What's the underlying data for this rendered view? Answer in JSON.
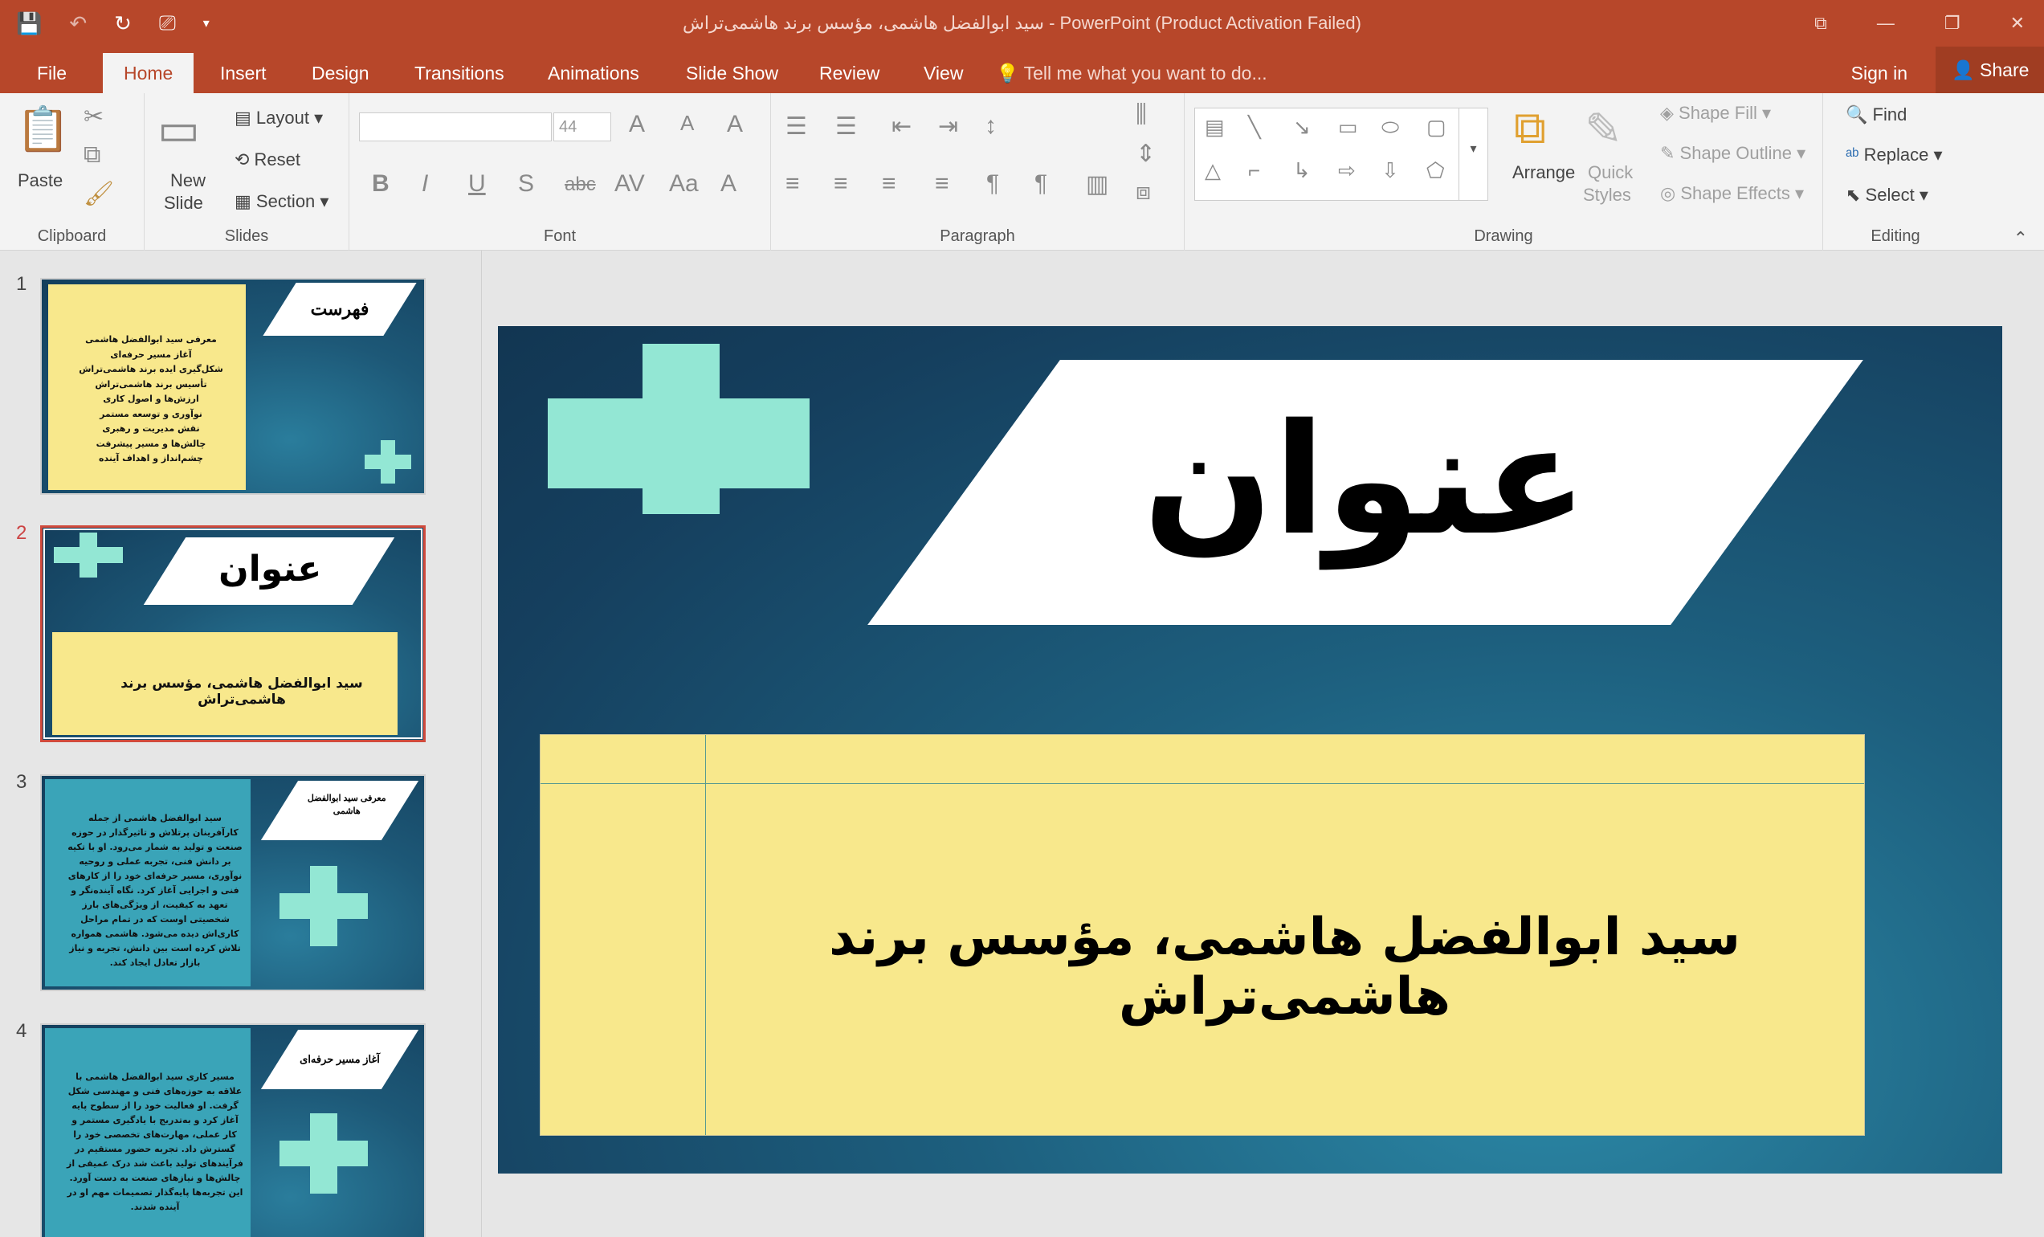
{
  "window": {
    "title": "سید ابوالفضل هاشمی، مؤسس برند هاشمی‌تراش  -  PowerPoint (Product Activation Failed)",
    "controls": [
      "⧉",
      "—",
      "❐",
      "✕"
    ]
  },
  "qat": [
    "save-icon",
    "undo-icon",
    "redo-icon",
    "present-icon",
    "customize-icon"
  ],
  "tabs": [
    "File",
    "Home",
    "Insert",
    "Design",
    "Transitions",
    "Animations",
    "Slide Show",
    "Review",
    "View"
  ],
  "tell_me": "Tell me what you want to do...",
  "sign_in": "Sign in",
  "share": "Share",
  "ribbon": {
    "clipboard": {
      "label": "Clipboard",
      "paste": "Paste"
    },
    "slides": {
      "label": "Slides",
      "new_slide": "New",
      "new_slide2": "Slide",
      "layout": "Layout",
      "reset": "Reset",
      "section": "Section"
    },
    "font": {
      "label": "Font",
      "size": "44",
      "bold": "B",
      "italic": "I",
      "underline": "U",
      "shadow": "S",
      "strike": "abc",
      "spacing": "AV",
      "case": "Aa",
      "color": "A"
    },
    "paragraph": {
      "label": "Paragraph"
    },
    "drawing": {
      "label": "Drawing",
      "arrange": "Arrange",
      "quick": "Quick",
      "styles": "Styles",
      "fill": "Shape Fill",
      "outline": "Shape Outline",
      "effects": "Shape Effects"
    },
    "editing": {
      "label": "Editing",
      "find": "Find",
      "replace": "Replace",
      "select": "Select"
    }
  },
  "thumbs": [
    {
      "num": "1",
      "title": "فهرست",
      "items": [
        "معرفی سید ابوالفضل هاشمی",
        "آغاز مسیر حرفه‌ای",
        "شکل‌گیری ایده برند هاشمی‌تراش",
        "تأسیس برند هاشمی‌تراش",
        "ارزش‌ها و اصول کاری",
        "نوآوری و توسعه مستمر",
        "نقش مدیریت و رهبری",
        "چالش‌ها و مسیر پیشرفت",
        "چشم‌انداز و اهداف آینده"
      ]
    },
    {
      "num": "2",
      "title": "عنوان",
      "sub": "سید ابوالفضل هاشمی، مؤسس برند هاشمی‌تراش"
    },
    {
      "num": "3",
      "title": "معرفی سید ابوالفضل هاشمی",
      "body": "سید ابوالفضل هاشمی از جمله کارآفرینان پرتلاش و تاثیرگذار در حوزه صنعت و تولید به شمار می‌رود. او با تکیه بر دانش فنی، تجربه عملی و روحیه نوآوری، مسیر حرفه‌ای خود را از کارهای فنی و اجرایی آغاز کرد. نگاه آینده‌نگر و تعهد به کیفیت، از ویژگی‌های بارز شخصیتی اوست که در تمام مراحل کاری‌اش دیده می‌شود. هاشمی همواره تلاش کرده است بین دانش، تجربه و نیاز بازار تعادل ایجاد کند."
    },
    {
      "num": "4",
      "title": "آغاز مسیر حرفه‌ای",
      "body": "مسیر کاری سید ابوالفضل هاشمی با علاقه به حوزه‌های فنی و مهندسی شکل گرفت. او فعالیت خود را از سطوح پایه آغاز کرد و به‌تدریج با یادگیری مستمر و کار عملی، مهارت‌های تخصصی خود را گسترش داد. تجربه حضور مستقیم در فرآیندهای تولید باعث شد درک عمیقی از چالش‌ها و نیازهای صنعت به دست آورد. این تجربه‌ها پایه‌گذار تصمیمات مهم او در آینده شدند."
    }
  ],
  "slide": {
    "title": "عنوان",
    "subtitle": "سید ابوالفضل هاشمی، مؤسس برند هاشمی‌تراش"
  }
}
